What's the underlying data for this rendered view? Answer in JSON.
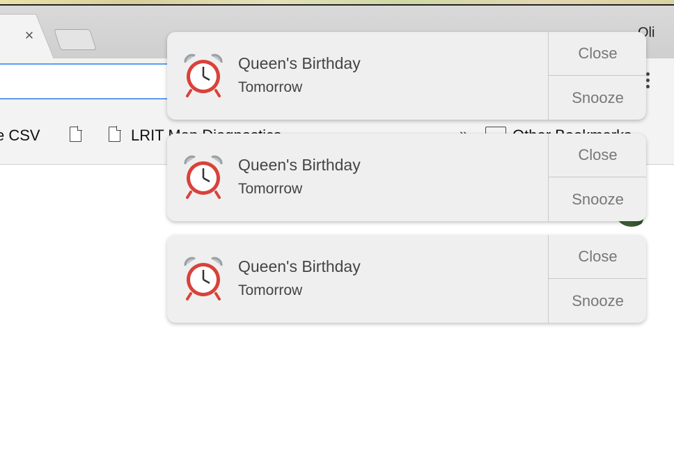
{
  "browser": {
    "profile_name": "Oli",
    "tab_close_glyph": "×",
    "bookmarks": [
      {
        "label": "e CSV"
      },
      {
        "label": "LRIT Map Diagnostics"
      },
      {
        "label": "Other Bookmarks"
      }
    ],
    "overflow_glyph": "»"
  },
  "notifications": [
    {
      "title": "Queen's Birthday",
      "subtitle": "Tomorrow",
      "close_label": "Close",
      "snooze_label": "Snooze",
      "icon": "alarm-clock-icon"
    },
    {
      "title": "Queen's Birthday",
      "subtitle": "Tomorrow",
      "close_label": "Close",
      "snooze_label": "Snooze",
      "icon": "alarm-clock-icon"
    },
    {
      "title": "Queen's Birthday",
      "subtitle": "Tomorrow",
      "close_label": "Close",
      "snooze_label": "Snooze",
      "icon": "alarm-clock-icon"
    }
  ],
  "colors": {
    "accent": "#5b9cf0",
    "notification_bg": "#efefef",
    "clock_red": "#d8423a"
  }
}
